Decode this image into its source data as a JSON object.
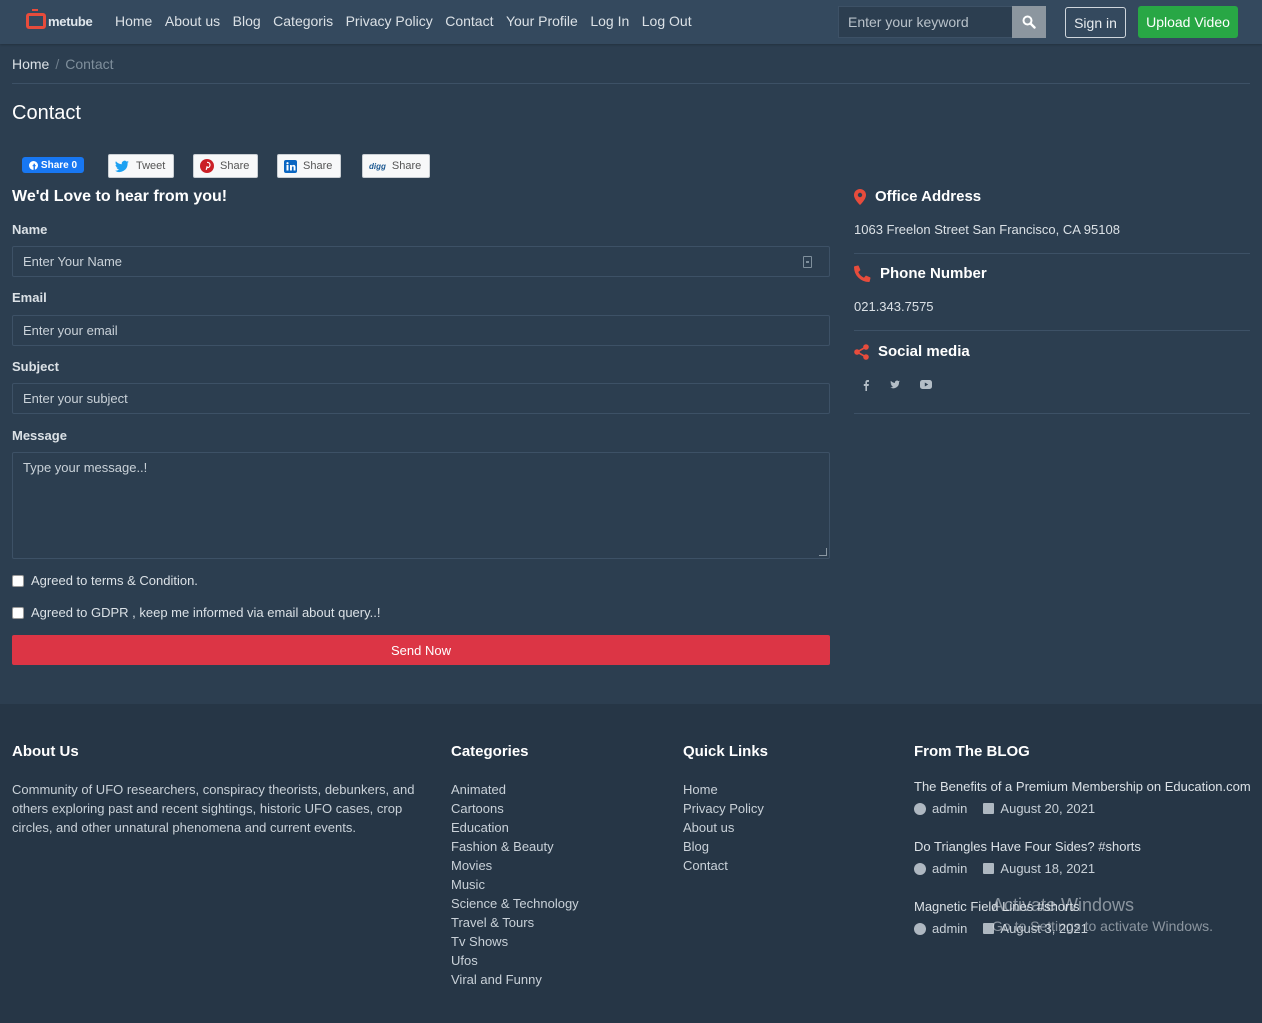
{
  "nav": {
    "logo": "metube",
    "links": [
      "Home",
      "About us",
      "Blog",
      "Categoris",
      "Privacy Policy",
      "Contact",
      "Your Profile",
      "Log In",
      "Log Out"
    ],
    "search_placeholder": "Enter your keyword",
    "signin": "Sign in",
    "upload": "Upload Video"
  },
  "breadcrumb": {
    "home": "Home",
    "current": "Contact"
  },
  "page_title": "Contact",
  "share": {
    "facebook": "Share 0",
    "twitter": "Tweet",
    "pinterest": "Share",
    "linkedin": "Share",
    "digg": "Share",
    "digg_logo": "digg"
  },
  "form": {
    "heading": "We'd Love to hear from you!",
    "name_label": "Name",
    "name_placeholder": "Enter Your Name",
    "email_label": "Email",
    "email_placeholder": "Enter your email",
    "subject_label": "Subject",
    "subject_placeholder": "Enter your subject",
    "message_label": "Message",
    "message_placeholder": "Type your message..!",
    "terms": "Agreed to terms & Condition.",
    "gdpr": "Agreed to GDPR , keep me informed via email about query..!",
    "send": "Send Now"
  },
  "contact_info": {
    "office_heading": "Office Address",
    "office_text": "1063 Freelon Street San Francisco, CA 95108",
    "phone_heading": "Phone Number",
    "phone_text": "021.343.7575",
    "social_heading": "Social media",
    "social_icons": [
      "facebook-icon",
      "twitter-icon",
      "youtube-icon"
    ]
  },
  "footer": {
    "about_heading": "About Us",
    "about_text": "Community of UFO researchers, conspiracy theorists, debunkers, and others exploring past and recent sightings, historic UFO cases, crop circles, and other unnatural phenomena and current events.",
    "categories_heading": "Categories",
    "categories": [
      "Animated",
      "Cartoons",
      "Education",
      "Fashion & Beauty",
      "Movies",
      "Music",
      "Science & Technology",
      "Travel & Tours",
      "Tv Shows",
      "Ufos",
      "Viral and Funny"
    ],
    "quick_heading": "Quick Links",
    "quick_links": [
      "Home",
      "Privacy Policy",
      "About us",
      "Blog",
      "Contact"
    ],
    "blog_heading": "From The BLOG",
    "blog_posts": [
      {
        "title": "The Benefits of a Premium Membership on Education.com",
        "author": "admin",
        "date": "August 20, 2021"
      },
      {
        "title": "Do Triangles Have Four Sides? #shorts",
        "author": "admin",
        "date": "August 18, 2021"
      },
      {
        "title": "Magnetic Field Lines #shorts",
        "author": "admin",
        "date": "August 3, 2021"
      }
    ]
  },
  "watermark": {
    "line1": "Activate Windows",
    "line2": "Go to Settings to activate Windows."
  },
  "colors": {
    "background": "#2c3e50",
    "navbar": "#34495e",
    "footer": "#263646",
    "accent_red": "#dc3545",
    "accent_green": "#28a745"
  }
}
